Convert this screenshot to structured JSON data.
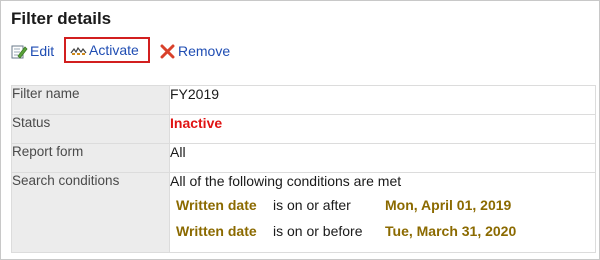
{
  "page": {
    "title": "Filter details"
  },
  "toolbar": {
    "edit": {
      "label": "Edit",
      "icon": "edit-icon"
    },
    "activate": {
      "label": "Activate",
      "icon": "activate-icon",
      "highlight_color": "#d21f1f"
    },
    "remove": {
      "label": "Remove",
      "icon": "remove-icon"
    }
  },
  "details": {
    "filter_name": {
      "label": "Filter name",
      "value": "FY2019"
    },
    "status": {
      "label": "Status",
      "value": "Inactive",
      "color": "#e01414"
    },
    "report_form": {
      "label": "Report form",
      "value": "All"
    },
    "search_conditions": {
      "label": "Search conditions",
      "summary": "All of the following conditions are met",
      "conditions": [
        {
          "field": "Written date",
          "operator": "is on or after",
          "date": "Mon, April 01, 2019"
        },
        {
          "field": "Written date",
          "operator": "is on or before",
          "date": "Tue, March 31, 2020"
        }
      ]
    }
  },
  "colors": {
    "link": "#1f4db3",
    "label_bg": "#ececec",
    "condition_accent": "#8b6a00"
  }
}
